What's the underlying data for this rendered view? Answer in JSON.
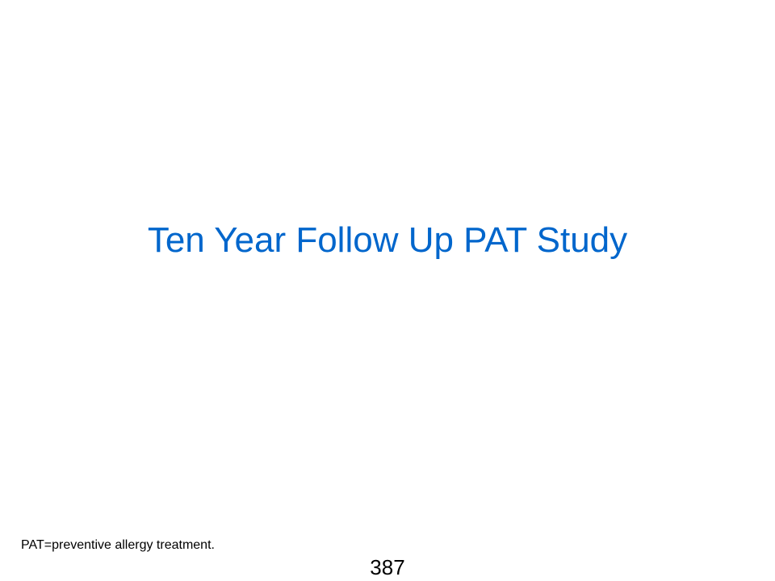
{
  "slide": {
    "title": "Ten Year Follow Up PAT Study",
    "footnote": "PAT=preventive allergy treatment.",
    "page_number": "387"
  },
  "colors": {
    "title": "#0066CC",
    "text": "#000000",
    "background": "#FFFFFF"
  }
}
